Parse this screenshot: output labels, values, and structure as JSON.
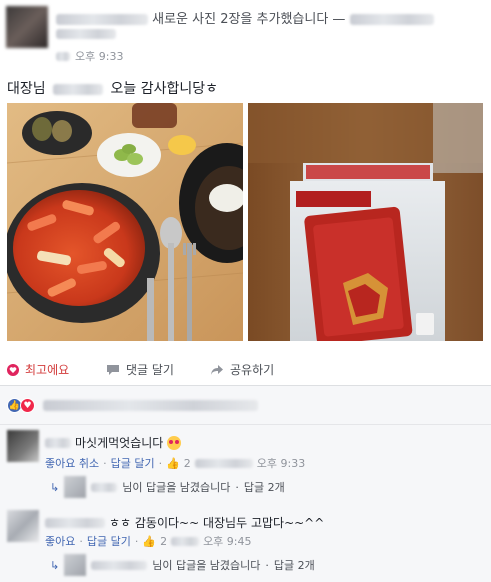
{
  "header": {
    "action_text": "새로운 사진 2장을 추가했습니다 —",
    "timestamp": "오후 9:33"
  },
  "post": {
    "text_before": "대장님",
    "text_after": "오늘 감사합니당ㅎ"
  },
  "actions": {
    "like_label": "최고에요",
    "comment_label": "댓글 달기",
    "share_label": "공유하기"
  },
  "comments": [
    {
      "text": "마싯게먹엇습니다",
      "actions": [
        "좋아요 취소",
        "답글 달기"
      ],
      "like_count": "2",
      "time": "오후 9:33",
      "reply_text": "님이 답글을 남겼습니다",
      "reply_count": "답글 2개"
    },
    {
      "text": "ㅎㅎ 감동이다~~ 대장님두 고맙다~~^^",
      "actions": [
        "좋아요",
        "답글 달기"
      ],
      "like_count": "2",
      "time": "오후 9:45",
      "reply_text": "님이 답글을 남겼습니다",
      "reply_count": "답글 2개"
    }
  ],
  "colors": {
    "like_red": "#d33c3c",
    "link_blue": "#4267b2",
    "meta_gray": "#90949c"
  }
}
